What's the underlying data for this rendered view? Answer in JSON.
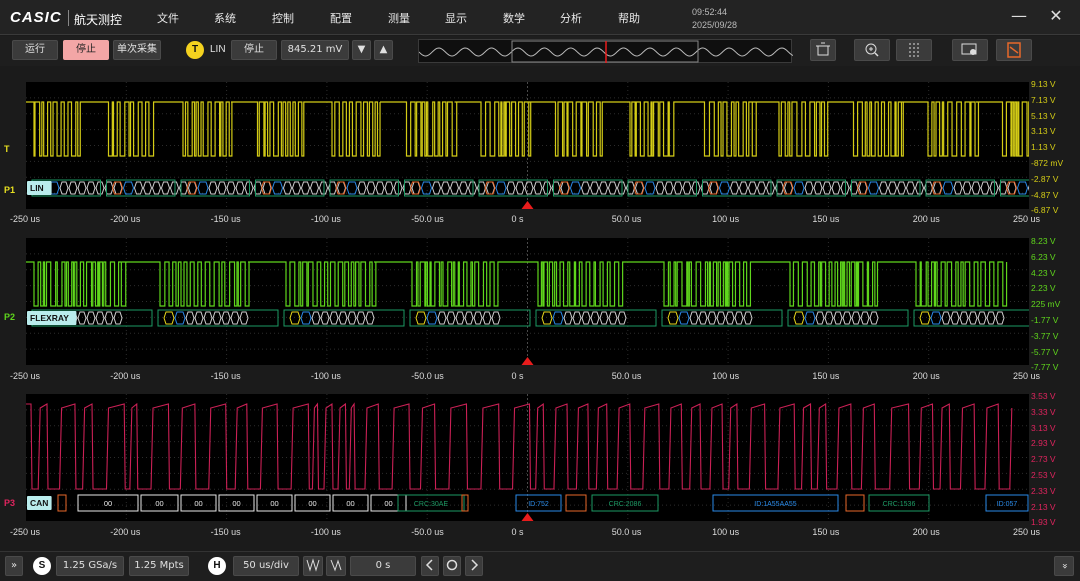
{
  "brand": {
    "logo": "CASIC",
    "company": "航天测控"
  },
  "menu": [
    "文件",
    "系统",
    "控制",
    "配置",
    "测量",
    "显示",
    "数学",
    "分析",
    "帮助"
  ],
  "clock": {
    "time": "09:52:44",
    "date": "2025/09/28"
  },
  "window": {
    "minimize": "—",
    "close": "✕"
  },
  "toolbar": {
    "run": "运行",
    "stop": "停止",
    "single": "单次采集",
    "trigger_badge": "T",
    "trigger_type": "LIN",
    "trigger_state": "停止",
    "trigger_level": "845.21 mV",
    "down": "▼",
    "up": "▲"
  },
  "colors": {
    "ch1": "#d4cc16",
    "ch2": "#5fd61c",
    "ch3": "#e0245e",
    "trigger": "#e81c1c"
  },
  "x_ticks": [
    "-250 us",
    "-200 us",
    "-150 us",
    "-100 us",
    "-50.0 us",
    "0 s",
    "50.0 us",
    "100 us",
    "150 us",
    "200 us",
    "250 us"
  ],
  "ch1": {
    "marker": "P1",
    "protocol": "LIN",
    "ticks": [
      "9.13 V",
      "7.13 V",
      "5.13 V",
      "3.13 V",
      "1.13 V",
      "-872 mV",
      "-2.87 V",
      "-4.87 V",
      "-6.87 V"
    ],
    "trig_marker": "T"
  },
  "ch2": {
    "marker": "P2",
    "protocol": "FLEXRAY",
    "ticks": [
      "8.23 V",
      "6.23 V",
      "4.23 V",
      "2.23 V",
      "225 mV",
      "-1.77 V",
      "-3.77 V",
      "-5.77 V",
      "-7.77 V"
    ]
  },
  "ch3": {
    "marker": "P3",
    "protocol": "CAN",
    "ticks": [
      "3.53 V",
      "3.33 V",
      "3.13 V",
      "2.93 V",
      "2.73 V",
      "2.53 V",
      "2.33 V",
      "2.13 V",
      "1.93 V"
    ],
    "frames": [
      "00",
      "00",
      "00",
      "00",
      "00",
      "00",
      "00",
      "00",
      "CRC:30AE",
      "ID:752",
      "CRC:2086",
      "ID:1A55AA55",
      "CRC:1536",
      "ID:057"
    ]
  },
  "bottom": {
    "expand": "»",
    "s_badge": "S",
    "sample_rate": "1.25 GSa/s",
    "memory": "1.25 Mpts",
    "h_badge": "H",
    "timebase": "50 us/div",
    "offset": "0 s",
    "collapse": "»"
  }
}
